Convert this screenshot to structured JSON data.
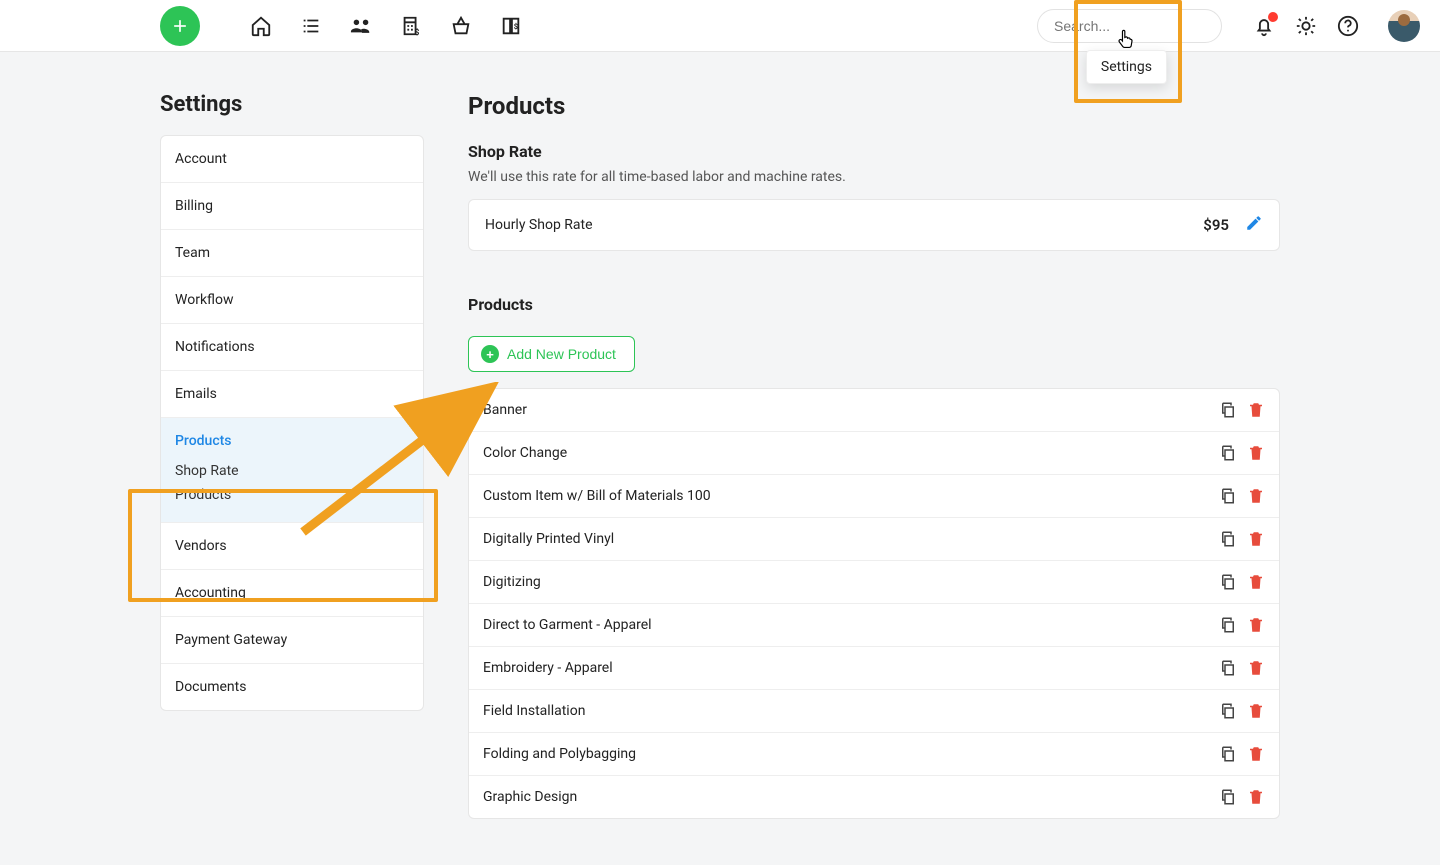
{
  "topbar": {
    "search_placeholder": "Search...",
    "tooltip_settings": "Settings"
  },
  "sidebar": {
    "title": "Settings",
    "items": [
      {
        "label": "Account"
      },
      {
        "label": "Billing"
      },
      {
        "label": "Team"
      },
      {
        "label": "Workflow"
      },
      {
        "label": "Notifications"
      },
      {
        "label": "Emails"
      },
      {
        "label": "Products",
        "active": true,
        "sub": [
          "Shop Rate",
          "Products"
        ]
      },
      {
        "label": "Vendors"
      },
      {
        "label": "Accounting"
      },
      {
        "label": "Payment Gateway"
      },
      {
        "label": "Documents"
      }
    ]
  },
  "main": {
    "title": "Products",
    "shop_rate": {
      "heading": "Shop Rate",
      "description": "We'll use this rate for all time-based labor and machine rates.",
      "row_label": "Hourly Shop Rate",
      "row_value": "$95"
    },
    "products_section": {
      "heading": "Products",
      "add_button": "Add New Product",
      "items": [
        "Banner",
        "Color Change",
        "Custom Item w/ Bill of Materials 100",
        "Digitally Printed Vinyl",
        "Digitizing",
        "Direct to Garment - Apparel",
        "Embroidery - Apparel",
        "Field Installation",
        "Folding and Polybagging",
        "Graphic Design"
      ]
    }
  }
}
